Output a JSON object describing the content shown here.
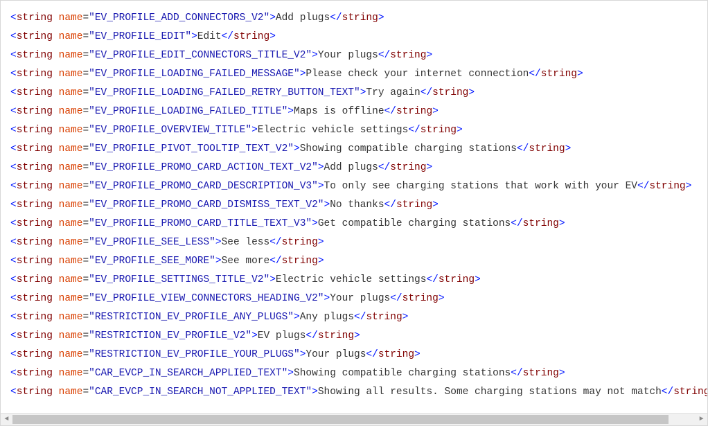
{
  "strings": [
    {
      "name": "EV_PROFILE_ADD_CONNECTORS_V2",
      "value": "Add plugs"
    },
    {
      "name": "EV_PROFILE_EDIT",
      "value": "Edit"
    },
    {
      "name": "EV_PROFILE_EDIT_CONNECTORS_TITLE_V2",
      "value": "Your plugs"
    },
    {
      "name": "EV_PROFILE_LOADING_FAILED_MESSAGE",
      "value": "Please check your internet connection"
    },
    {
      "name": "EV_PROFILE_LOADING_FAILED_RETRY_BUTTON_TEXT",
      "value": "Try again"
    },
    {
      "name": "EV_PROFILE_LOADING_FAILED_TITLE",
      "value": "Maps is offline"
    },
    {
      "name": "EV_PROFILE_OVERVIEW_TITLE",
      "value": "Electric vehicle settings"
    },
    {
      "name": "EV_PROFILE_PIVOT_TOOLTIP_TEXT_V2",
      "value": "Showing compatible charging stations"
    },
    {
      "name": "EV_PROFILE_PROMO_CARD_ACTION_TEXT_V2",
      "value": "Add plugs"
    },
    {
      "name": "EV_PROFILE_PROMO_CARD_DESCRIPTION_V3",
      "value": "To only see charging stations that work with your EV"
    },
    {
      "name": "EV_PROFILE_PROMO_CARD_DISMISS_TEXT_V2",
      "value": "No thanks"
    },
    {
      "name": "EV_PROFILE_PROMO_CARD_TITLE_TEXT_V3",
      "value": "Get compatible charging stations"
    },
    {
      "name": "EV_PROFILE_SEE_LESS",
      "value": "See less"
    },
    {
      "name": "EV_PROFILE_SEE_MORE",
      "value": "See more"
    },
    {
      "name": "EV_PROFILE_SETTINGS_TITLE_V2",
      "value": "Electric vehicle settings"
    },
    {
      "name": "EV_PROFILE_VIEW_CONNECTORS_HEADING_V2",
      "value": "Your plugs"
    },
    {
      "name": "RESTRICTION_EV_PROFILE_ANY_PLUGS",
      "value": "Any plugs"
    },
    {
      "name": "RESTRICTION_EV_PROFILE_V2",
      "value": "EV plugs"
    },
    {
      "name": "RESTRICTION_EV_PROFILE_YOUR_PLUGS",
      "value": "Your plugs"
    },
    {
      "name": "CAR_EVCP_IN_SEARCH_APPLIED_TEXT",
      "value": "Showing compatible charging stations"
    },
    {
      "name": "CAR_EVCP_IN_SEARCH_NOT_APPLIED_TEXT",
      "value": "Showing all results. Some charging stations may not match"
    }
  ],
  "syntax": {
    "open_bracket": "<",
    "close_bracket": ">",
    "end_open": "</",
    "tag_name": "string",
    "attr_name": "name",
    "eq": "=",
    "quote": "\""
  },
  "scrollbar": {
    "left_arrow": "◄",
    "right_arrow": "►"
  }
}
